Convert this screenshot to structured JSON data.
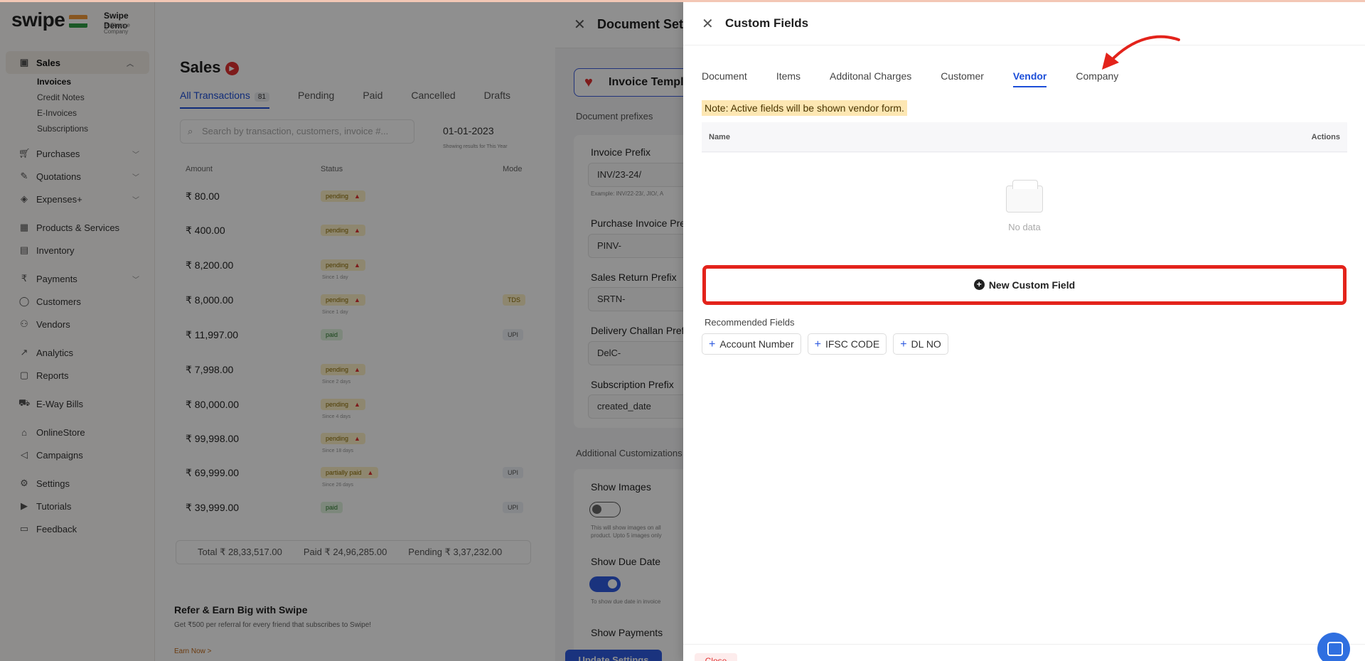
{
  "app": {
    "logo": "swipe",
    "company_name": "Swipe Demo",
    "company_sub": "⇄ Change Company"
  },
  "sidebar": {
    "sales": "Sales",
    "sales_sub": [
      "Invoices",
      "Credit Notes",
      "E-Invoices",
      "Subscriptions"
    ],
    "group1": [
      "Purchases",
      "Quotations",
      "Expenses+"
    ],
    "group2": [
      "Products & Services",
      "Inventory"
    ],
    "group3": [
      "Payments",
      "Customers",
      "Vendors"
    ],
    "group4": [
      "Analytics",
      "Reports"
    ],
    "group5": [
      "E-Way Bills"
    ],
    "group6": [
      "OnlineStore",
      "Campaigns"
    ],
    "group7": [
      "Settings",
      "Tutorials",
      "Feedback"
    ]
  },
  "sales_page": {
    "title": "Sales",
    "tabs": [
      {
        "label": "All Transactions",
        "count": "81"
      },
      {
        "label": "Pending"
      },
      {
        "label": "Paid"
      },
      {
        "label": "Cancelled"
      },
      {
        "label": "Drafts"
      }
    ],
    "search_placeholder": "Search by transaction, customers, invoice #...",
    "date": "01-01-2023",
    "date_sub": "Showing results for This Year",
    "columns": {
      "amount": "Amount",
      "status": "Status",
      "mode": "Mode"
    },
    "rows": [
      {
        "amount": "₹ 80.00",
        "status": "pending",
        "sub": "",
        "mode": ""
      },
      {
        "amount": "₹ 400.00",
        "status": "pending",
        "sub": "",
        "mode": ""
      },
      {
        "amount": "₹ 8,200.00",
        "status": "pending",
        "sub": "Since 1 day",
        "mode": ""
      },
      {
        "amount": "₹ 8,000.00",
        "status": "pending",
        "sub": "Since 1 day",
        "mode": "TDS"
      },
      {
        "amount": "₹ 11,997.00",
        "status": "paid",
        "sub": "",
        "mode": "UPI"
      },
      {
        "amount": "₹ 7,998.00",
        "status": "pending",
        "sub": "Since 2 days",
        "mode": ""
      },
      {
        "amount": "₹ 80,000.00",
        "status": "pending",
        "sub": "Since 4 days",
        "mode": ""
      },
      {
        "amount": "₹ 99,998.00",
        "status": "pending",
        "sub": "Since 18 days",
        "mode": ""
      },
      {
        "amount": "₹ 69,999.00",
        "status": "partially paid",
        "sub": "Since 26 days",
        "mode": "UPI"
      },
      {
        "amount": "₹ 39,999.00",
        "status": "paid",
        "sub": "",
        "mode": "UPI"
      }
    ],
    "totals": {
      "total": "Total ₹ 28,33,517.00",
      "paid": "Paid ₹ 24,96,285.00",
      "pending": "Pending ₹ 3,37,232.00"
    },
    "refer_title": "Refer & Earn Big with Swipe",
    "refer_sub": "Get ₹500 per referral for every friend that subscribes to Swipe!",
    "earn": "Earn Now >"
  },
  "doc_settings": {
    "title": "Document Settings",
    "template_label": "Invoice Templates",
    "prefixes_label": "Document prefixes",
    "fields": [
      {
        "label": "Invoice Prefix",
        "value": "INV/23-24/",
        "hint": "Example: INV/22-23/, JIO/, A"
      },
      {
        "label": "Purchase Invoice Prefix",
        "value": "PINV-"
      },
      {
        "label": "Sales Return Prefix",
        "value": "SRTN-"
      },
      {
        "label": "Delivery Challan Prefix",
        "value": "DelC-"
      },
      {
        "label": "Subscription Prefix",
        "value": "created_date"
      }
    ],
    "additional_label": "Additional Customizations",
    "show_images": "Show Images",
    "show_images_hint": "This will show images on all product. Upto 5 images only",
    "show_due_date": "Show Due Date",
    "show_due_date_hint": "To show due date in invoice",
    "show_payments": "Show Payments",
    "update_button": "Update Settings"
  },
  "custom_fields": {
    "title": "Custom Fields",
    "tabs": [
      "Document",
      "Items",
      "Additonal Charges",
      "Customer",
      "Vendor",
      "Company"
    ],
    "active_tab": "Vendor",
    "note": "Note: Active fields will be shown vendor form.",
    "table": {
      "name_header": "Name",
      "actions_header": "Actions",
      "empty": "No data"
    },
    "new_button": "New Custom Field",
    "recommended_label": "Recommended Fields",
    "recommended": [
      "Account Number",
      "IFSC CODE",
      "DL NO"
    ],
    "close_button": "Close"
  },
  "colors": {
    "accent": "#2f5be0",
    "highlight": "#e3231b",
    "note_bg": "#fde7b3"
  }
}
